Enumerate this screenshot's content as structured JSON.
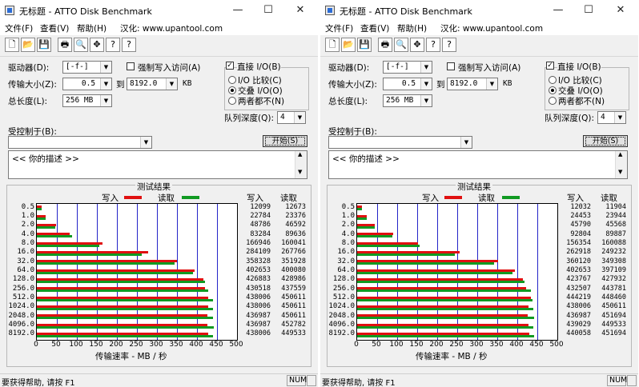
{
  "windows": [
    {
      "title": "无标题 - ATTO Disk Benchmark",
      "menu": [
        "文件(F)",
        "查看(V)",
        "帮助(H)",
        "汉化: www.upantool.com"
      ],
      "drive_label": "驱动器(D):",
      "drive_value": "[-f-]",
      "force_write_label": "强制写入访问(A)",
      "direct_io_label": "直接 I/O(B)",
      "transfer_label": "传输大小(Z):",
      "transfer_from": "0.5",
      "to_label": "到",
      "transfer_to": "8192.0",
      "unit_kb": "KB",
      "total_label": "总长度(L):",
      "total_value": "256 MB",
      "radio_io_compare": "I/O 比较(C)",
      "radio_overlap": "交叠 I/O(O)",
      "radio_neither": "两者都不(N)",
      "queue_label": "队列深度(Q):",
      "queue_value": "4",
      "controlled_label": "受控制于(B):",
      "start_button": "开始(S)",
      "desc_text": "<<  你的描述   >>",
      "results_title": "测试结果",
      "legend_write": "写入",
      "legend_read": "读取",
      "col_write": "写入",
      "col_read": "读取",
      "xaxis_label": "传输速率 - MB / 秒",
      "status_text": "要获得帮助, 请按 F1",
      "status_num": "NUM",
      "colors": {
        "write": "#e01010",
        "read": "#119a22",
        "grid": "#2424c8"
      }
    },
    {
      "title": "无标题 - ATTO Disk Benchmark",
      "menu": [
        "文件(F)",
        "查看(V)",
        "帮助(H)",
        "汉化: www.upantool.com"
      ],
      "drive_label": "驱动器(D):",
      "drive_value": "[-f-]",
      "force_write_label": "强制写入访问(A)",
      "direct_io_label": "直接 I/O(B)",
      "transfer_label": "传输大小(Z):",
      "transfer_from": "0.5",
      "to_label": "到",
      "transfer_to": "8192.0",
      "unit_kb": "KB",
      "total_label": "总长度(L):",
      "total_value": "256 MB",
      "radio_io_compare": "I/O 比较(C)",
      "radio_overlap": "交叠 I/O(O)",
      "radio_neither": "两者都不(N)",
      "queue_label": "队列深度(Q):",
      "queue_value": "4",
      "controlled_label": "受控制于(B):",
      "start_button": "开始(S)",
      "desc_text": "<<  你的描述   >>",
      "results_title": "测试结果",
      "legend_write": "写入",
      "legend_read": "读取",
      "col_write": "写入",
      "col_read": "读取",
      "xaxis_label": "传输速率 - MB / 秒",
      "status_text": "要获得帮助, 请按 F1",
      "status_num": "NUM",
      "colors": {
        "write": "#e01010",
        "read": "#119a22",
        "grid": "#2424c8"
      }
    }
  ],
  "chart_data": [
    {
      "type": "bar",
      "title": "测试结果",
      "xlabel": "传输速率 - MB / 秒",
      "xlim": [
        0,
        500
      ],
      "xticks": [
        "0",
        "50",
        "100",
        "150",
        "200",
        "250",
        "300",
        "350",
        "400",
        "450",
        "500"
      ],
      "categories": [
        "0.5",
        "1.0",
        "2.0",
        "4.0",
        "8.0",
        "16.0",
        "32.0",
        "64.0",
        "128.0",
        "256.0",
        "512.0",
        "1024.0",
        "2048.0",
        "4096.0",
        "8192.0"
      ],
      "series": [
        {
          "name": "写入",
          "values": [
            12099,
            22784,
            48786,
            83284,
            166946,
            284109,
            358328,
            402653,
            426883,
            430518,
            438006,
            438006,
            436987,
            436987,
            438006
          ]
        },
        {
          "name": "读取",
          "values": [
            12673,
            23376,
            46592,
            89636,
            160041,
            267766,
            351928,
            400080,
            428986,
            437559,
            450611,
            450611,
            450611,
            452782,
            449533
          ]
        }
      ],
      "legend": "top"
    },
    {
      "type": "bar",
      "title": "测试结果",
      "xlabel": "传输速率 - MB / 秒",
      "xlim": [
        0,
        500
      ],
      "xticks": [
        "0",
        "50",
        "100",
        "150",
        "200",
        "250",
        "300",
        "350",
        "400",
        "450",
        "500"
      ],
      "categories": [
        "0.5",
        "1.0",
        "2.0",
        "4.0",
        "8.0",
        "16.0",
        "32.0",
        "64.0",
        "128.0",
        "256.0",
        "512.0",
        "1024.0",
        "2048.0",
        "4096.0",
        "8192.0"
      ],
      "series": [
        {
          "name": "写入",
          "values": [
            12032,
            24453,
            45790,
            92804,
            156354,
            262918,
            360120,
            402653,
            423767,
            432507,
            444219,
            438006,
            436987,
            439029,
            440058
          ]
        },
        {
          "name": "读取",
          "values": [
            11904,
            23944,
            45568,
            89887,
            160088,
            249232,
            349308,
            397109,
            427932,
            443781,
            448460,
            450611,
            451694,
            449533,
            451694
          ]
        }
      ],
      "legend": "top"
    }
  ]
}
